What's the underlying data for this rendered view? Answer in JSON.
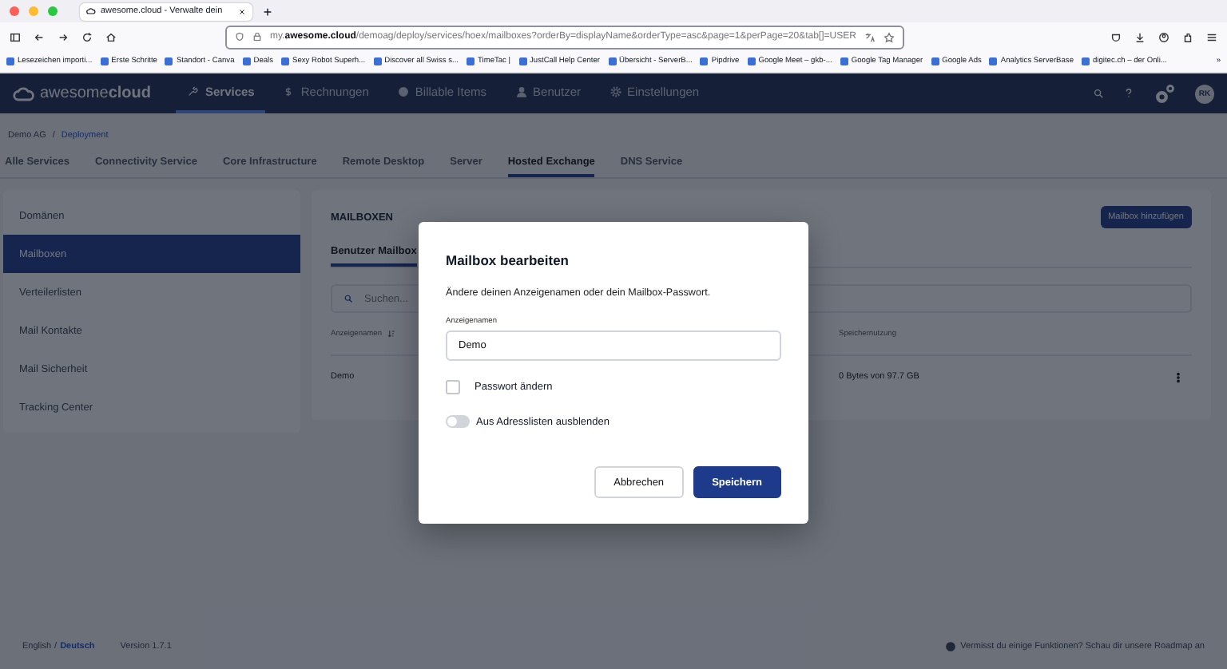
{
  "browser": {
    "tab_title": "awesome.cloud - Verwalte dein",
    "url": "my.**awesome.cloud**/demoag/deploy/services/hoex/mailboxes?orderBy=displayName&orderType=asc&page=1&perPage=20&tab[]=USER",
    "bookmarks": [
      "Lesezeichen importi...",
      "Erste Schritte",
      "Standort - Canva",
      "Deals",
      "Sexy Robot Superh...",
      "Discover all Swiss s...",
      "TimeTac |",
      "JustCall Help Center",
      "Übersicht - ServerB...",
      "Pipdrive",
      "Google Meet – gkb-...",
      "Google Tag Manager",
      "Google Ads",
      "Analytics ServerBase",
      "digitec.ch – der Onli..."
    ],
    "more": "»"
  },
  "nav": {
    "logo": "awesome**cloud**",
    "items": [
      {
        "label": "Services",
        "selected": true
      },
      {
        "label": "Rechnungen",
        "selected": false
      },
      {
        "label": "Billable Items",
        "selected": false
      },
      {
        "label": "Benutzer",
        "selected": false
      },
      {
        "label": "Einstellungen",
        "selected": false
      }
    ],
    "avatar": "RK"
  },
  "breadcrumb": {
    "items": [
      "Demo AG",
      "Deployment"
    ],
    "separator": "/"
  },
  "service_tabs": [
    {
      "label": "Alle Services",
      "selected": false
    },
    {
      "label": "Connectivity Service",
      "selected": false
    },
    {
      "label": "Core Infrastructure",
      "selected": false
    },
    {
      "label": "Remote Desktop",
      "selected": false
    },
    {
      "label": "Server",
      "selected": false
    },
    {
      "label": "Hosted Exchange",
      "selected": true
    },
    {
      "label": "DNS Service",
      "selected": false
    }
  ],
  "sidebar": [
    {
      "label": "Domänen",
      "selected": false
    },
    {
      "label": "Mailboxen",
      "selected": true
    },
    {
      "label": "Verteilerlisten",
      "selected": false
    },
    {
      "label": "Mail Kontakte",
      "selected": false
    },
    {
      "label": "Mail Sicherheit",
      "selected": false
    },
    {
      "label": "Tracking Center",
      "selected": false
    }
  ],
  "panel": {
    "title": "MAILBOXEN",
    "add_button": "Mailbox hinzufügen",
    "subtabs": [
      {
        "label": "Benutzer Mailbox",
        "selected": true
      }
    ],
    "search": {
      "placeholder": "Suchen..."
    },
    "columns": [
      "Anzeigenamen",
      "Speichernutzung"
    ],
    "rows": [
      {
        "name": "Demo",
        "storage": "0 Bytes von 97.7 GB"
      }
    ]
  },
  "modal": {
    "title": "Mailbox bearbeiten",
    "description": "Ändere deinen Anzeigenamen oder dein Mailbox-Passwort.",
    "field": {
      "label": "Anzeigenamen",
      "value": "Demo"
    },
    "checkbox": {
      "label": "Passwort ändern",
      "checked": false
    },
    "toggle": {
      "label": "Aus Adresslisten ausblenden",
      "on": false
    },
    "cancel": "Abbrechen",
    "save": "Speichern"
  },
  "footer": {
    "languages": [
      {
        "label": "English",
        "selected": false
      },
      {
        "label": "Deutsch",
        "selected": true
      }
    ],
    "separator": "/",
    "version": "Version 1.7.1",
    "notice": "Vermisst du einige Funktionen? Schau dir unsere Roadmap an"
  }
}
